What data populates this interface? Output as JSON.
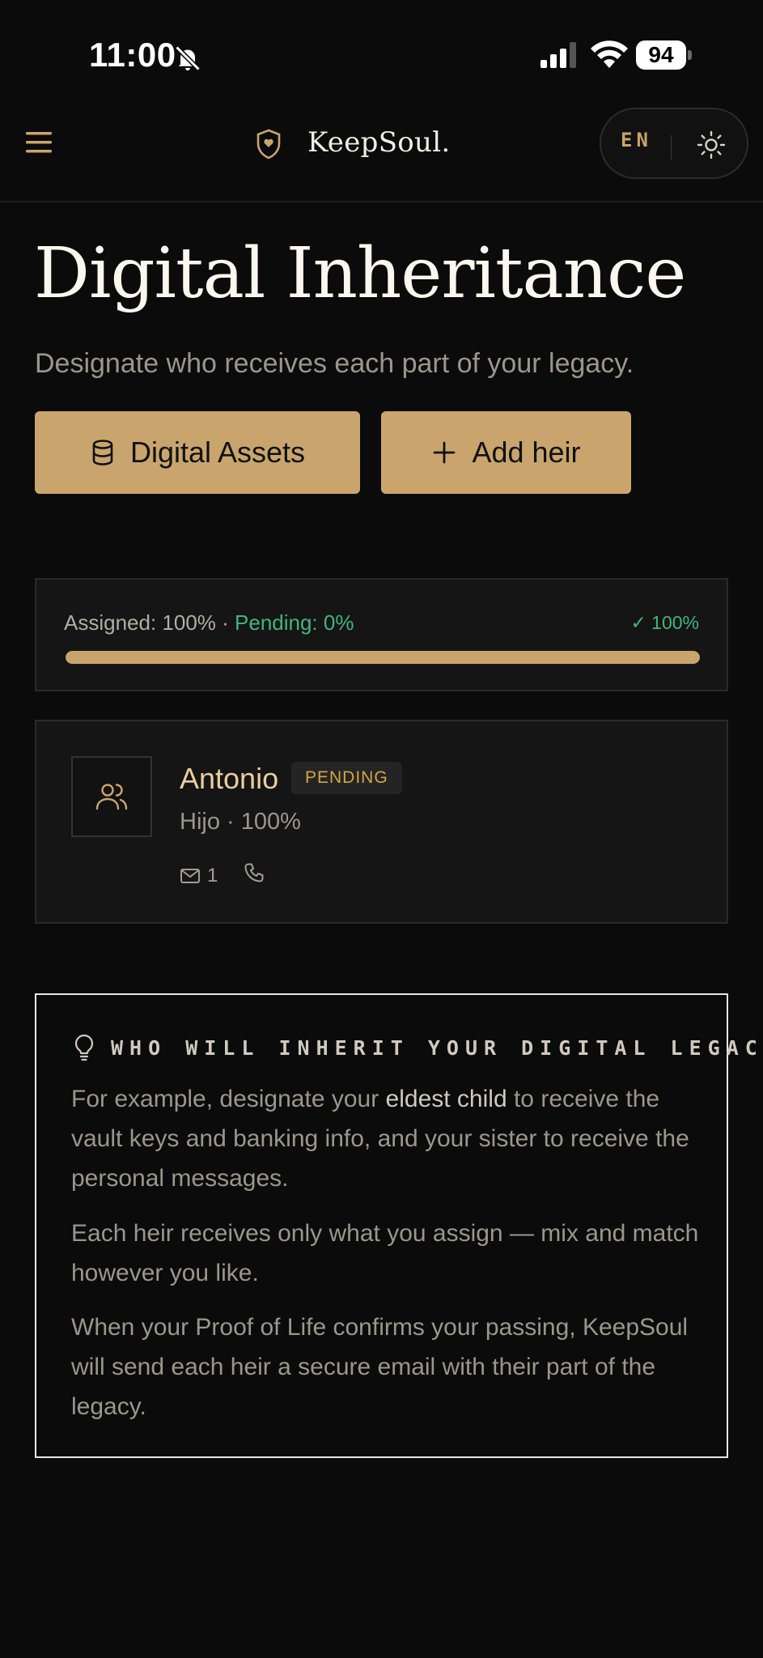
{
  "status_bar": {
    "time": "11:00",
    "battery": "94"
  },
  "header": {
    "brand": "KeepSoul.",
    "language": "EN"
  },
  "page": {
    "title": "Digital Inheritance",
    "subtitle": "Designate who receives each part of your legacy."
  },
  "actions": {
    "digital_assets_label": "Digital Assets",
    "add_heir_label": "Add heir"
  },
  "progress": {
    "assigned_text": "Assigned: 100%",
    "separator": " · ",
    "pending_text": "Pending: 0%",
    "complete_text": "✓ 100%",
    "fraction": 1.0
  },
  "heir": {
    "name": "Antonio",
    "status": "PENDING",
    "relation_share": "Hijo · 100%",
    "email_count": "1"
  },
  "info": {
    "title": "WHO WILL INHERIT YOUR DIGITAL LEGACY",
    "p1_before": "For example, designate your ",
    "p1_bold": "eldest child",
    "p1_after": " to receive the vault keys and banking info, and your sister to receive the personal messages.",
    "p2": "Each heir receives only what you assign — mix and match however you like.",
    "p3": "When your Proof of Life confirms your passing, KeepSoul will send each heir a secure email with their part of the legacy."
  },
  "colors": {
    "accent": "#c9a56d",
    "success": "#41b57f",
    "badge": "#d3a63f",
    "background": "#0b0b0b"
  }
}
